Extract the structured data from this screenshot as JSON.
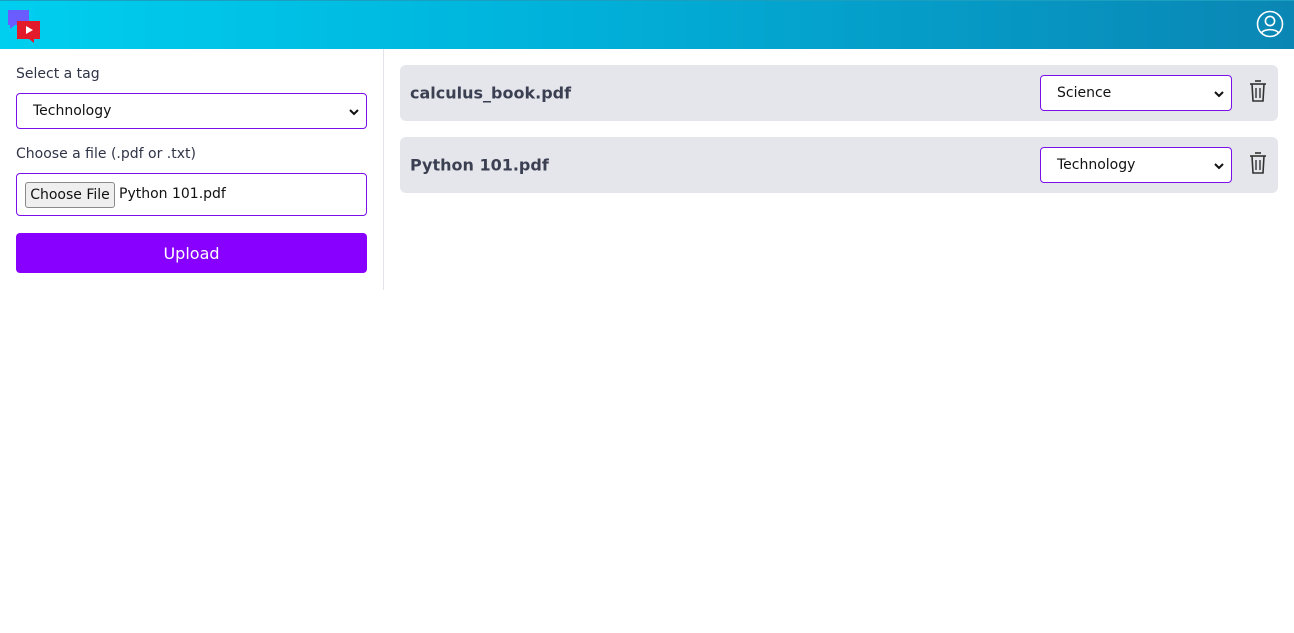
{
  "header": {
    "logo_icon": "chat-play-logo-icon",
    "user_icon": "user-circle-icon",
    "brand_colors": {
      "gradient_start": "#00cff0",
      "gradient_end": "#0a86b4"
    }
  },
  "upload_form": {
    "tag_label": "Select a tag",
    "tag_selected": "Technology",
    "file_label": "Choose a file (.pdf or .txt)",
    "choose_file_label": "Choose File",
    "chosen_file_name": "Python 101.pdf",
    "upload_label": "Upload",
    "accent_color": "#8800ff"
  },
  "files": [
    {
      "name": "calculus_book.pdf",
      "tag": "Science",
      "delete_icon": "trash-icon"
    },
    {
      "name": "Python 101.pdf",
      "tag": "Technology",
      "delete_icon": "trash-icon"
    }
  ]
}
